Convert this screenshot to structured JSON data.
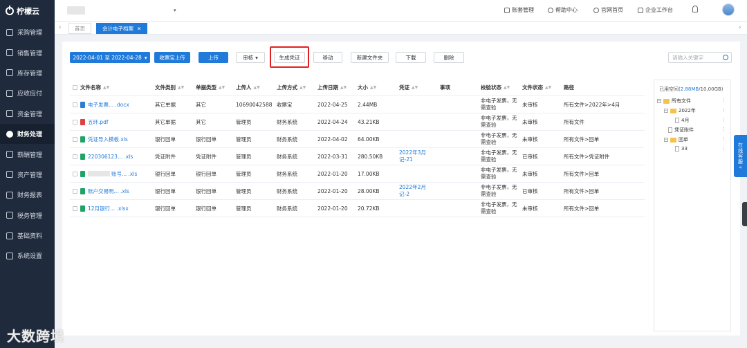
{
  "app": {
    "name": "柠檬云"
  },
  "sidebar": {
    "items": [
      {
        "label": "采购管理",
        "icon": "cart-icon"
      },
      {
        "label": "销售管理",
        "icon": "sales-icon"
      },
      {
        "label": "库存管理",
        "icon": "warehouse-icon"
      },
      {
        "label": "应收应付",
        "icon": "receivable-icon"
      },
      {
        "label": "资金管理",
        "icon": "fund-icon"
      },
      {
        "label": "财务处理",
        "icon": "finance-icon",
        "active": true
      },
      {
        "label": "薪酬管理",
        "icon": "salary-icon"
      },
      {
        "label": "资产管理",
        "icon": "asset-icon"
      },
      {
        "label": "财务报表",
        "icon": "report-icon"
      },
      {
        "label": "税务管理",
        "icon": "tax-icon"
      },
      {
        "label": "基础资料",
        "icon": "basic-data-icon"
      },
      {
        "label": "系统设置",
        "icon": "settings-icon"
      }
    ]
  },
  "topbar": {
    "links": {
      "account": "账套管理",
      "help": "帮助中心",
      "website": "官网首页",
      "workbench": "企业工作台"
    }
  },
  "tabs": {
    "home": "首页",
    "archive": "会计电子档案"
  },
  "toolbar": {
    "date_range": "2022-04-01 至 2022-04-28",
    "receipt_upload": "收票宝上传",
    "upload": "上传",
    "review": "审核",
    "generate_voucher": "生成凭证",
    "move": "移动",
    "new_folder": "新建文件夹",
    "download": "下载",
    "delete": "删除",
    "search_placeholder": "请输入关键字"
  },
  "table": {
    "headers": {
      "name": "文件名称",
      "category": "文件类别",
      "doc_type": "单据类型",
      "uploader": "上传人",
      "method": "上传方式",
      "date": "上传日期",
      "size": "大小",
      "voucher": "凭证",
      "matter": "事项",
      "check_status": "校验状态",
      "file_status": "文件状态",
      "path": "路径"
    },
    "rows": [
      {
        "name": "电子发票...  .docx",
        "ext": "docx",
        "category": "其它单据",
        "doc_type": "其它",
        "uploader": "10690042588",
        "method": "收票宝",
        "date": "2022-04-25",
        "size": "2.44MB",
        "voucher": "",
        "matter": "",
        "check_status": "非电子发票，无需查验",
        "file_status": "未审核",
        "path": "所有文件>2022年>4月"
      },
      {
        "name": "五环.pdf",
        "ext": "pdf",
        "category": "其它单据",
        "doc_type": "其它",
        "uploader": "管理员",
        "method": "财务系统",
        "date": "2022-04-24",
        "size": "43.21KB",
        "voucher": "",
        "matter": "",
        "check_status": "非电子发票，无需查验",
        "file_status": "未审核",
        "path": "所有文件"
      },
      {
        "name": "凭证导入模板.xls",
        "ext": "xls",
        "category": "银行回单",
        "doc_type": "银行回单",
        "uploader": "管理员",
        "method": "财务系统",
        "date": "2022-04-02",
        "size": "64.00KB",
        "voucher": "",
        "matter": "",
        "check_status": "非电子发票，无需查验",
        "file_status": "未审核",
        "path": "所有文件>回单"
      },
      {
        "name": "220306123...  .xls",
        "ext": "xls",
        "category": "凭证附件",
        "doc_type": "凭证附件",
        "uploader": "管理员",
        "method": "财务系统",
        "date": "2022-03-31",
        "size": "280.50KB",
        "voucher": "2022年3月记-21",
        "matter": "",
        "check_status": "非电子发票，无需查验",
        "file_status": "已审核",
        "path": "所有文件>凭证附件"
      },
      {
        "name": "账号...  .xls",
        "ext": "xls",
        "blurred": true,
        "category": "银行回单",
        "doc_type": "银行回单",
        "uploader": "管理员",
        "method": "财务系统",
        "date": "2022-01-20",
        "size": "17.00KB",
        "voucher": "",
        "matter": "",
        "check_status": "非电子发票，无需查验",
        "file_status": "未审核",
        "path": "所有文件>回单"
      },
      {
        "name": "账户交易明...  .xls",
        "ext": "xls",
        "category": "银行回单",
        "doc_type": "银行回单",
        "uploader": "管理员",
        "method": "财务系统",
        "date": "2022-01-20",
        "size": "28.00KB",
        "voucher": "2022年2月记-2",
        "matter": "",
        "check_status": "非电子发票，无需查验",
        "file_status": "已审核",
        "path": "所有文件>回单"
      },
      {
        "name": "12月银行...  .xlsx",
        "ext": "xls",
        "category": "银行回单",
        "doc_type": "银行回单",
        "uploader": "管理员",
        "method": "财务系统",
        "date": "2022-01-20",
        "size": "20.72KB",
        "voucher": "",
        "matter": "",
        "check_status": "非电子发票，无需查验",
        "file_status": "未审核",
        "path": "所有文件>回单"
      }
    ]
  },
  "tree": {
    "space_label": "已用空间(",
    "space_used": "2.88MB",
    "space_total": "/10,00GB)",
    "nodes": {
      "all": "所有文件",
      "y2022": "2022年",
      "apr": "4月",
      "voucher_attach": "凭证附件",
      "receipt": "回单",
      "n33": "33"
    }
  },
  "service": {
    "line1": "在",
    "line2": "线",
    "line3": "客",
    "line4": "服"
  },
  "watermark": "大数跨境"
}
